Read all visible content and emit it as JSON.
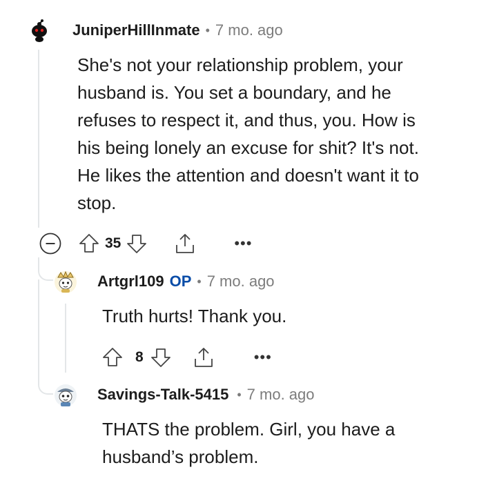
{
  "comments": [
    {
      "username": "JuniperHillInmate",
      "op_badge": "",
      "separator": "•",
      "time": "7 mo. ago",
      "body_lines": [
        "She's not your relationship problem, your",
        "husband is. You set a boundary, and he",
        "refuses to respect it, and thus, you. How is",
        "his being lonely an excuse for shit? It's not.",
        "He likes the attention and doesn't want it to",
        "stop."
      ],
      "score": "35",
      "more": "•••"
    },
    {
      "username": "Artgrl109",
      "op_badge": "OP",
      "separator": "•",
      "time": "7 mo. ago",
      "body_lines": [
        "Truth hurts! Thank you."
      ],
      "score": "8",
      "more": "•••"
    },
    {
      "username": "Savings-Talk-5415",
      "op_badge": "",
      "separator": "•",
      "time": "7 mo. ago",
      "body_lines": [
        "THATS the problem. Girl, you have a",
        "husband’s problem."
      ]
    }
  ],
  "icons": {
    "collapse": "collapse-minus-icon",
    "upvote": "upvote-arrow-icon",
    "downvote": "downvote-arrow-icon",
    "share": "share-icon",
    "more": "more-options-icon"
  },
  "colors": {
    "op_badge": "#0a4da8",
    "meta_gray": "#7c7c7c",
    "thread_line": "#e3e6e8"
  }
}
